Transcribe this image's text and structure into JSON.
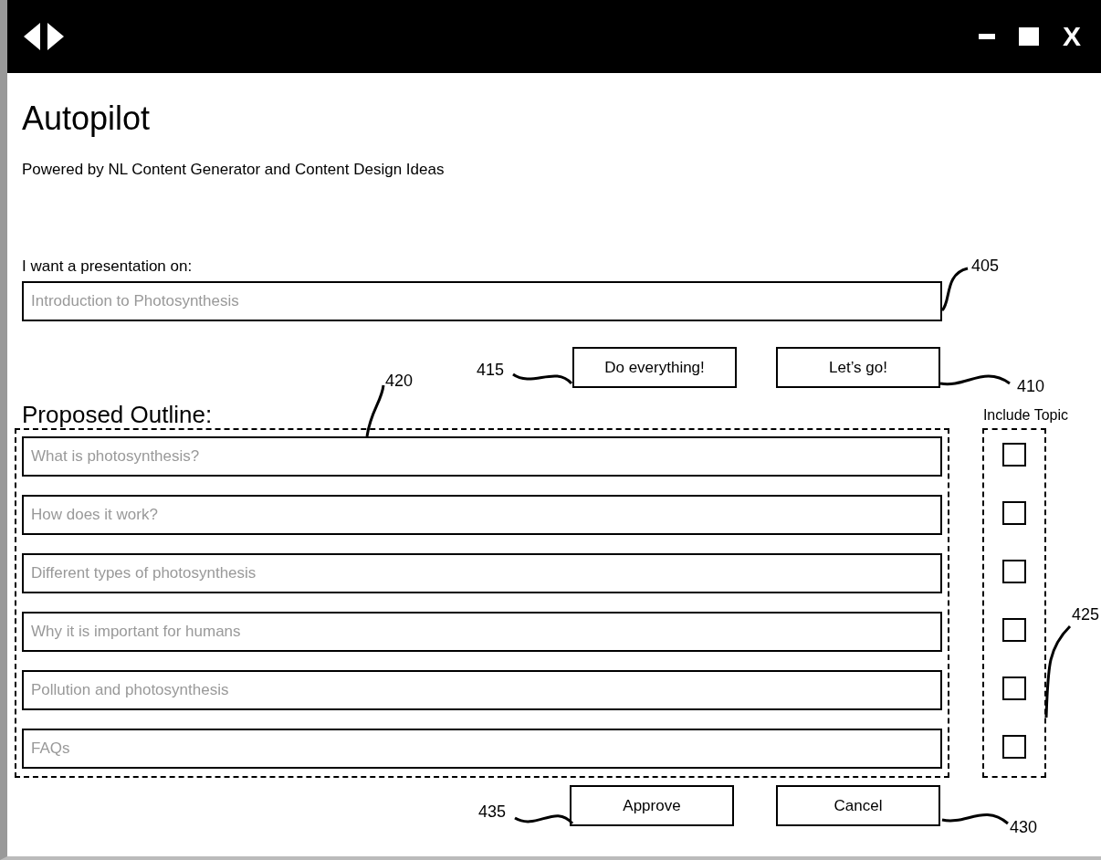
{
  "window": {
    "close_label": "X"
  },
  "title": "Autopilot",
  "subtitle": "Powered by NL Content Generator and Content Design Ideas",
  "prompt": {
    "label": "I want a presentation on:",
    "value": "Introduction to Photosynthesis"
  },
  "actions": [
    "Do everything!",
    "Let’s go!"
  ],
  "outline": {
    "heading": "Proposed Outline:",
    "include_heading": "Include Topic",
    "topics": [
      {
        "text": "What is photosynthesis?",
        "checked": false
      },
      {
        "text": "How does it work?",
        "checked": false
      },
      {
        "text": "Different types of photosynthesis",
        "checked": false
      },
      {
        "text": "Why it is important for humans",
        "checked": false
      },
      {
        "text": "Pollution and photosynthesis",
        "checked": false
      },
      {
        "text": "FAQs",
        "checked": false
      }
    ]
  },
  "footer_buttons": [
    "Approve",
    "Cancel"
  ],
  "reference_numerals": [
    "405",
    "415",
    "410",
    "420",
    "425",
    "435",
    "430"
  ]
}
